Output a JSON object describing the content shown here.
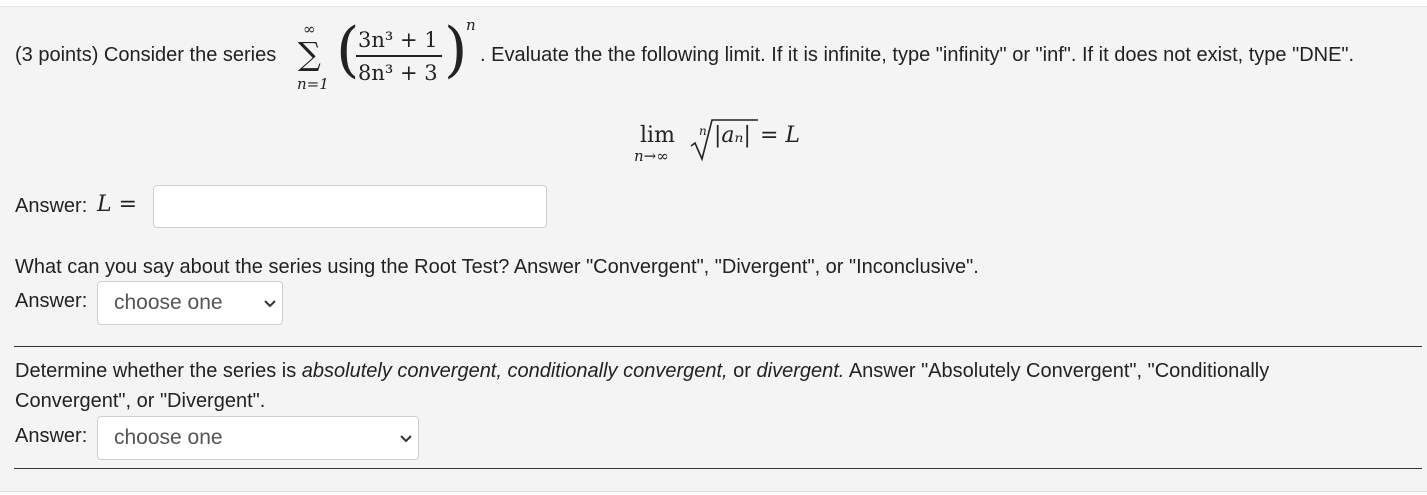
{
  "question": {
    "intro": "(3 points) Consider the series",
    "series": {
      "upper_limit": "∞",
      "sigma": "∑",
      "lower_limit": "n=1",
      "numerator": "3n³ + 1",
      "denominator": "8n³ + 3",
      "exponent": "n"
    },
    "instructions": ". Evaluate the the following limit. If it is infinite, type \"infinity\" or \"inf\". If it does not exist, type \"DNE\".",
    "limit": {
      "lim": "lim",
      "sub": "n→∞",
      "root_index": "n",
      "radicand": "|aₙ|",
      "rhs": "= L"
    }
  },
  "answer1": {
    "label": "Answer:",
    "var": "L =",
    "value": ""
  },
  "part2": {
    "prompt": "What can you say about the series using the Root Test? Answer \"Convergent\", \"Divergent\", or \"Inconclusive\".",
    "label": "Answer:",
    "select_value": "choose one"
  },
  "part3": {
    "prompt_before": "Determine whether the series is ",
    "prompt_italic1": "absolutely convergent, conditionally convergent,",
    "prompt_mid": " or ",
    "prompt_italic2": "divergent.",
    "prompt_after_line1": " Answer \"Absolutely Convergent\", \"Conditionally",
    "prompt_line2": "Convergent\", or \"Divergent\".",
    "label": "Answer:",
    "select_value": "choose one"
  }
}
